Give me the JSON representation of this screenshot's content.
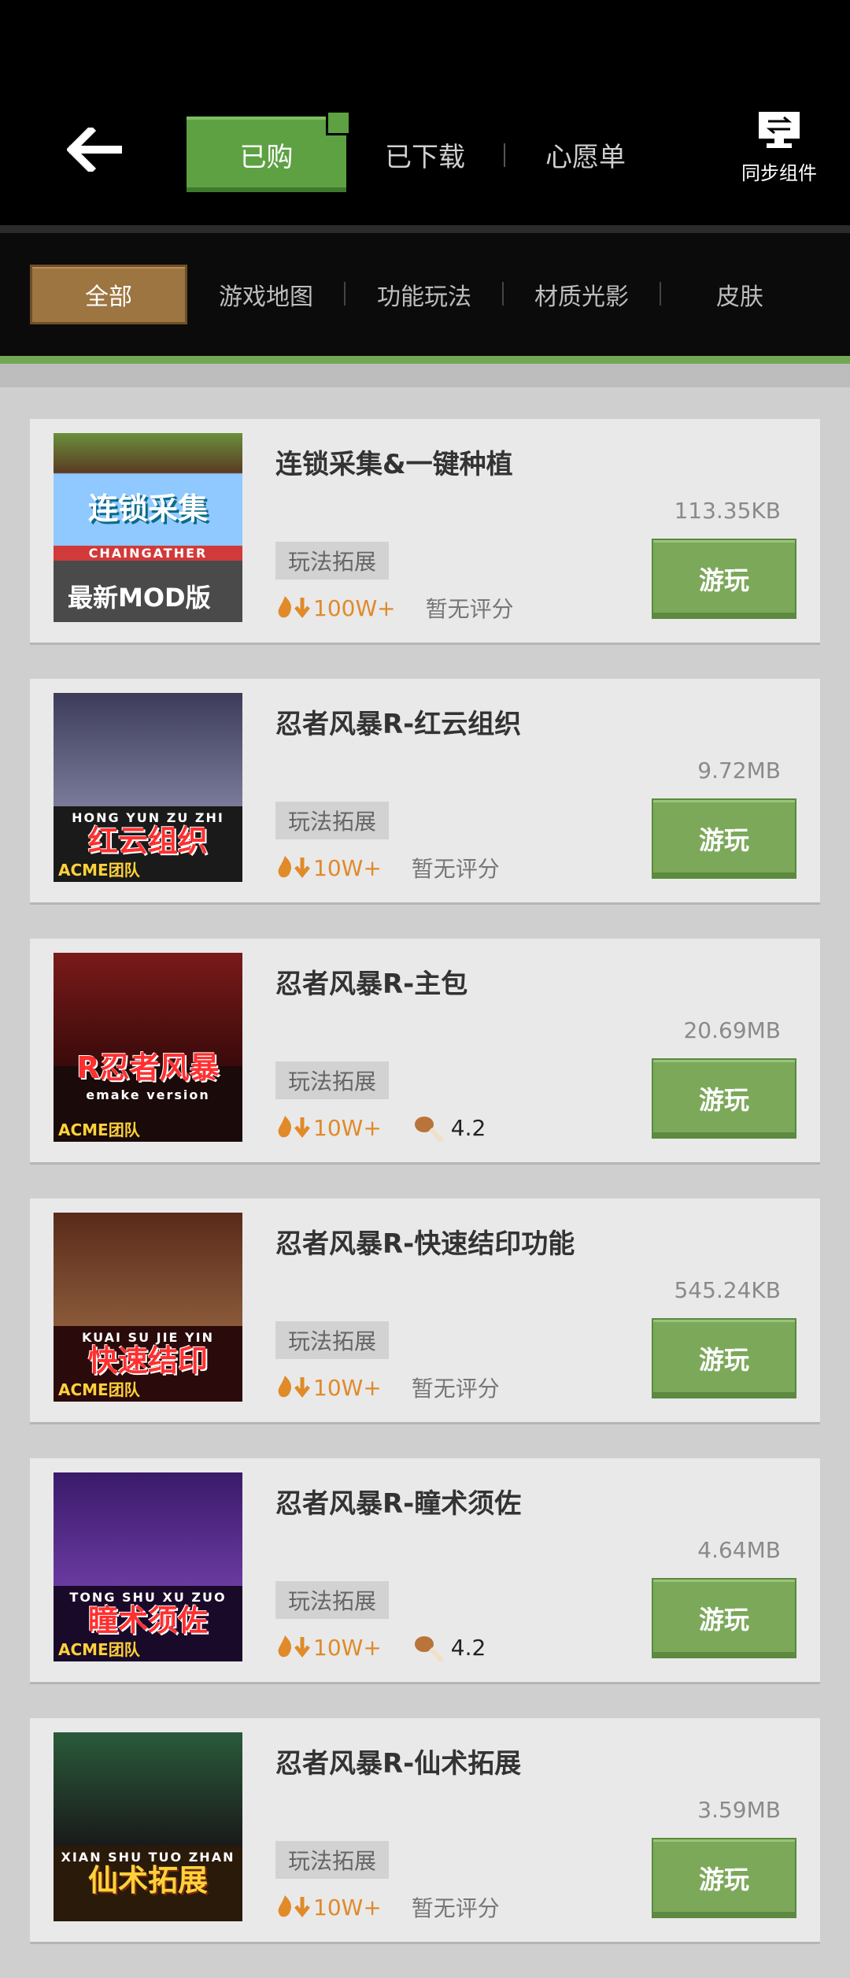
{
  "header": {
    "tabs": [
      {
        "label": "已购",
        "active": true
      },
      {
        "label": "已下载",
        "active": false
      },
      {
        "label": "心愿单",
        "active": false
      }
    ],
    "sync_label": "同步组件"
  },
  "categories": [
    {
      "label": "全部",
      "active": true
    },
    {
      "label": "游戏地图",
      "active": false
    },
    {
      "label": "功能玩法",
      "active": false
    },
    {
      "label": "材质光影",
      "active": false
    },
    {
      "label": "皮肤",
      "active": false
    }
  ],
  "items": [
    {
      "title": "连锁采集&一键种植",
      "size": "113.35KB",
      "tag": "玩法拓展",
      "downloads": "100W+",
      "rating": "暂无评分",
      "button": "游玩",
      "thumb_text": "连锁采集",
      "thumb_sub": "CHAINGATHER",
      "thumb_foot": "最新MOD版"
    },
    {
      "title": "忍者风暴R-红云组织",
      "size": "9.72MB",
      "tag": "玩法拓展",
      "downloads": "10W+",
      "rating": "暂无评分",
      "button": "游玩",
      "thumb_text": "红云组织",
      "thumb_sub": "HONG YUN ZU ZHI",
      "thumb_foot": "ACME团队"
    },
    {
      "title": "忍者风暴R-主包",
      "size": "20.69MB",
      "tag": "玩法拓展",
      "downloads": "10W+",
      "rating": "4.2",
      "button": "游玩",
      "thumb_text": "R忍者风暴",
      "thumb_sub": "emake version",
      "thumb_foot": "ACME团队"
    },
    {
      "title": "忍者风暴R-快速结印功能",
      "size": "545.24KB",
      "tag": "玩法拓展",
      "downloads": "10W+",
      "rating": "暂无评分",
      "button": "游玩",
      "thumb_text": "快速结印",
      "thumb_sub": "KUAI SU JIE YIN",
      "thumb_foot": "ACME团队"
    },
    {
      "title": "忍者风暴R-瞳术须佐",
      "size": "4.64MB",
      "tag": "玩法拓展",
      "downloads": "10W+",
      "rating": "4.2",
      "button": "游玩",
      "thumb_text": "瞳术须佐",
      "thumb_sub": "TONG SHU XU ZUO",
      "thumb_foot": "ACME团队"
    },
    {
      "title": "忍者风暴R-仙术拓展",
      "size": "3.59MB",
      "tag": "玩法拓展",
      "downloads": "10W+",
      "rating": "暂无评分",
      "button": "游玩",
      "thumb_text": "仙术拓展",
      "thumb_sub": "XIAN SHU TUO ZHAN",
      "thumb_foot": ""
    }
  ],
  "colors": {
    "accent_green": "#5da142",
    "play_green": "#7ca85a",
    "category_active": "#9d7541",
    "download_orange": "#e08a2a"
  }
}
